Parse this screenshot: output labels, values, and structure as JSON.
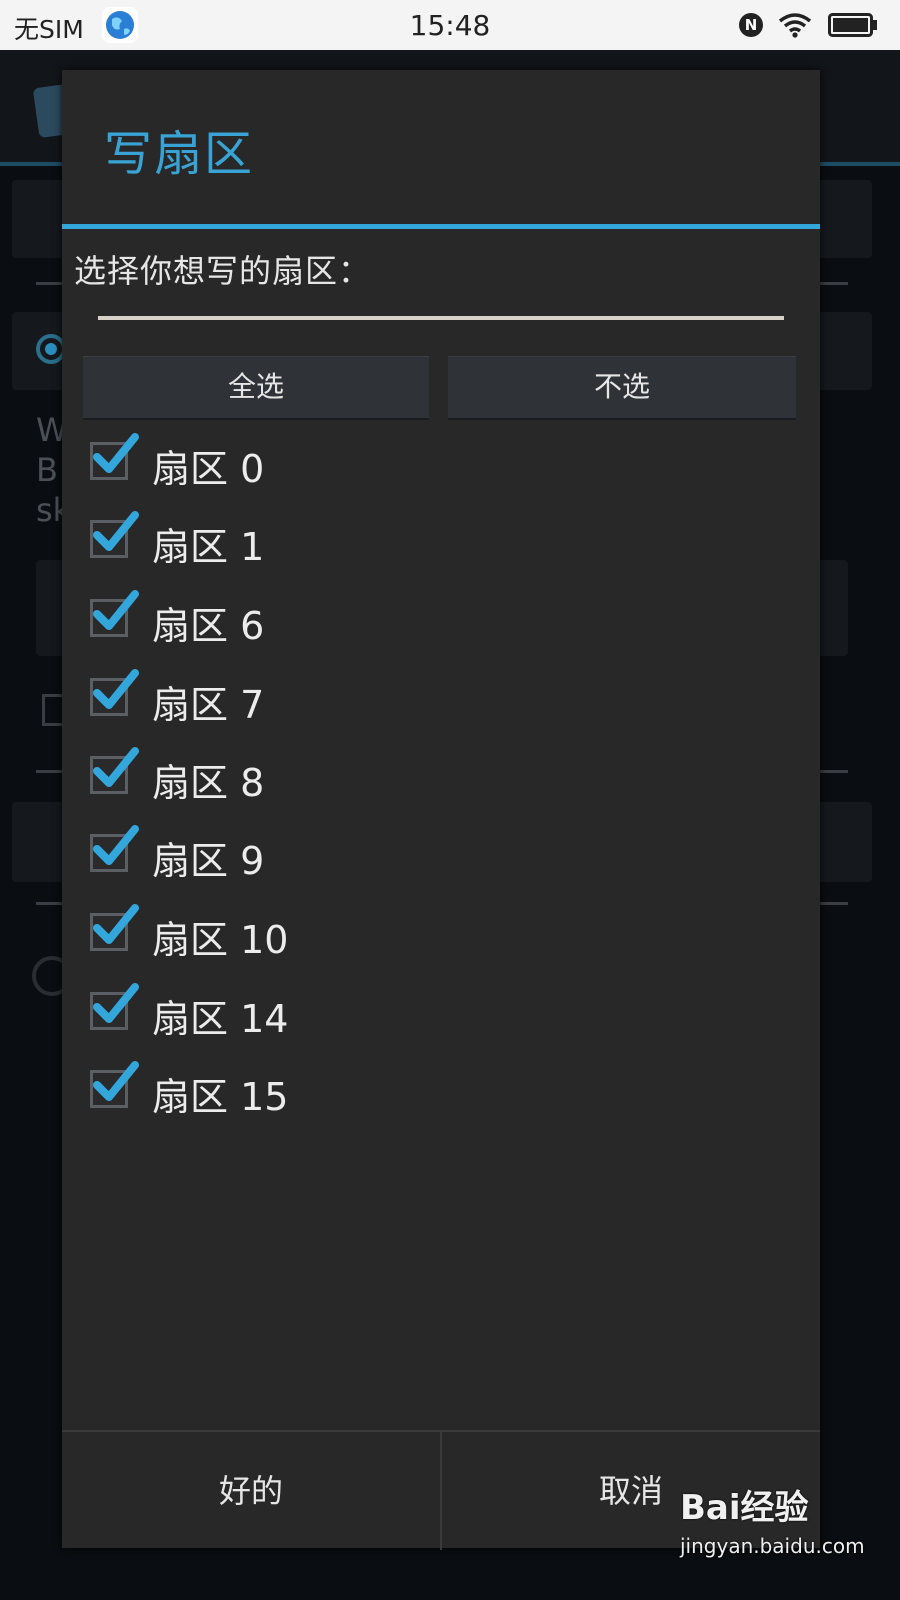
{
  "status_bar": {
    "carrier": "无SIM",
    "time": "15:48",
    "notification_icon": "N"
  },
  "dialog": {
    "title": "写扇区",
    "prompt": "选择你想写的扇区：",
    "input_value": "",
    "select_all_label": "全选",
    "select_none_label": "不选",
    "sectors": [
      {
        "label": "扇区 0",
        "checked": true
      },
      {
        "label": "扇区 1",
        "checked": true
      },
      {
        "label": "扇区 6",
        "checked": true
      },
      {
        "label": "扇区 7",
        "checked": true
      },
      {
        "label": "扇区 8",
        "checked": true
      },
      {
        "label": "扇区 9",
        "checked": true
      },
      {
        "label": "扇区 10",
        "checked": true
      },
      {
        "label": "扇区 14",
        "checked": true
      },
      {
        "label": "扇区 15",
        "checked": true
      }
    ],
    "ok_label": "好的",
    "cancel_label": "取消"
  },
  "background": {
    "text_lines": [
      "W",
      "B",
      "sk"
    ]
  },
  "watermark": {
    "brand": "Bai经验",
    "url": "jingyan.baidu.com"
  },
  "colors": {
    "accent": "#33a6dc",
    "dialog_bg": "#282828",
    "check": "#33a6dc"
  }
}
